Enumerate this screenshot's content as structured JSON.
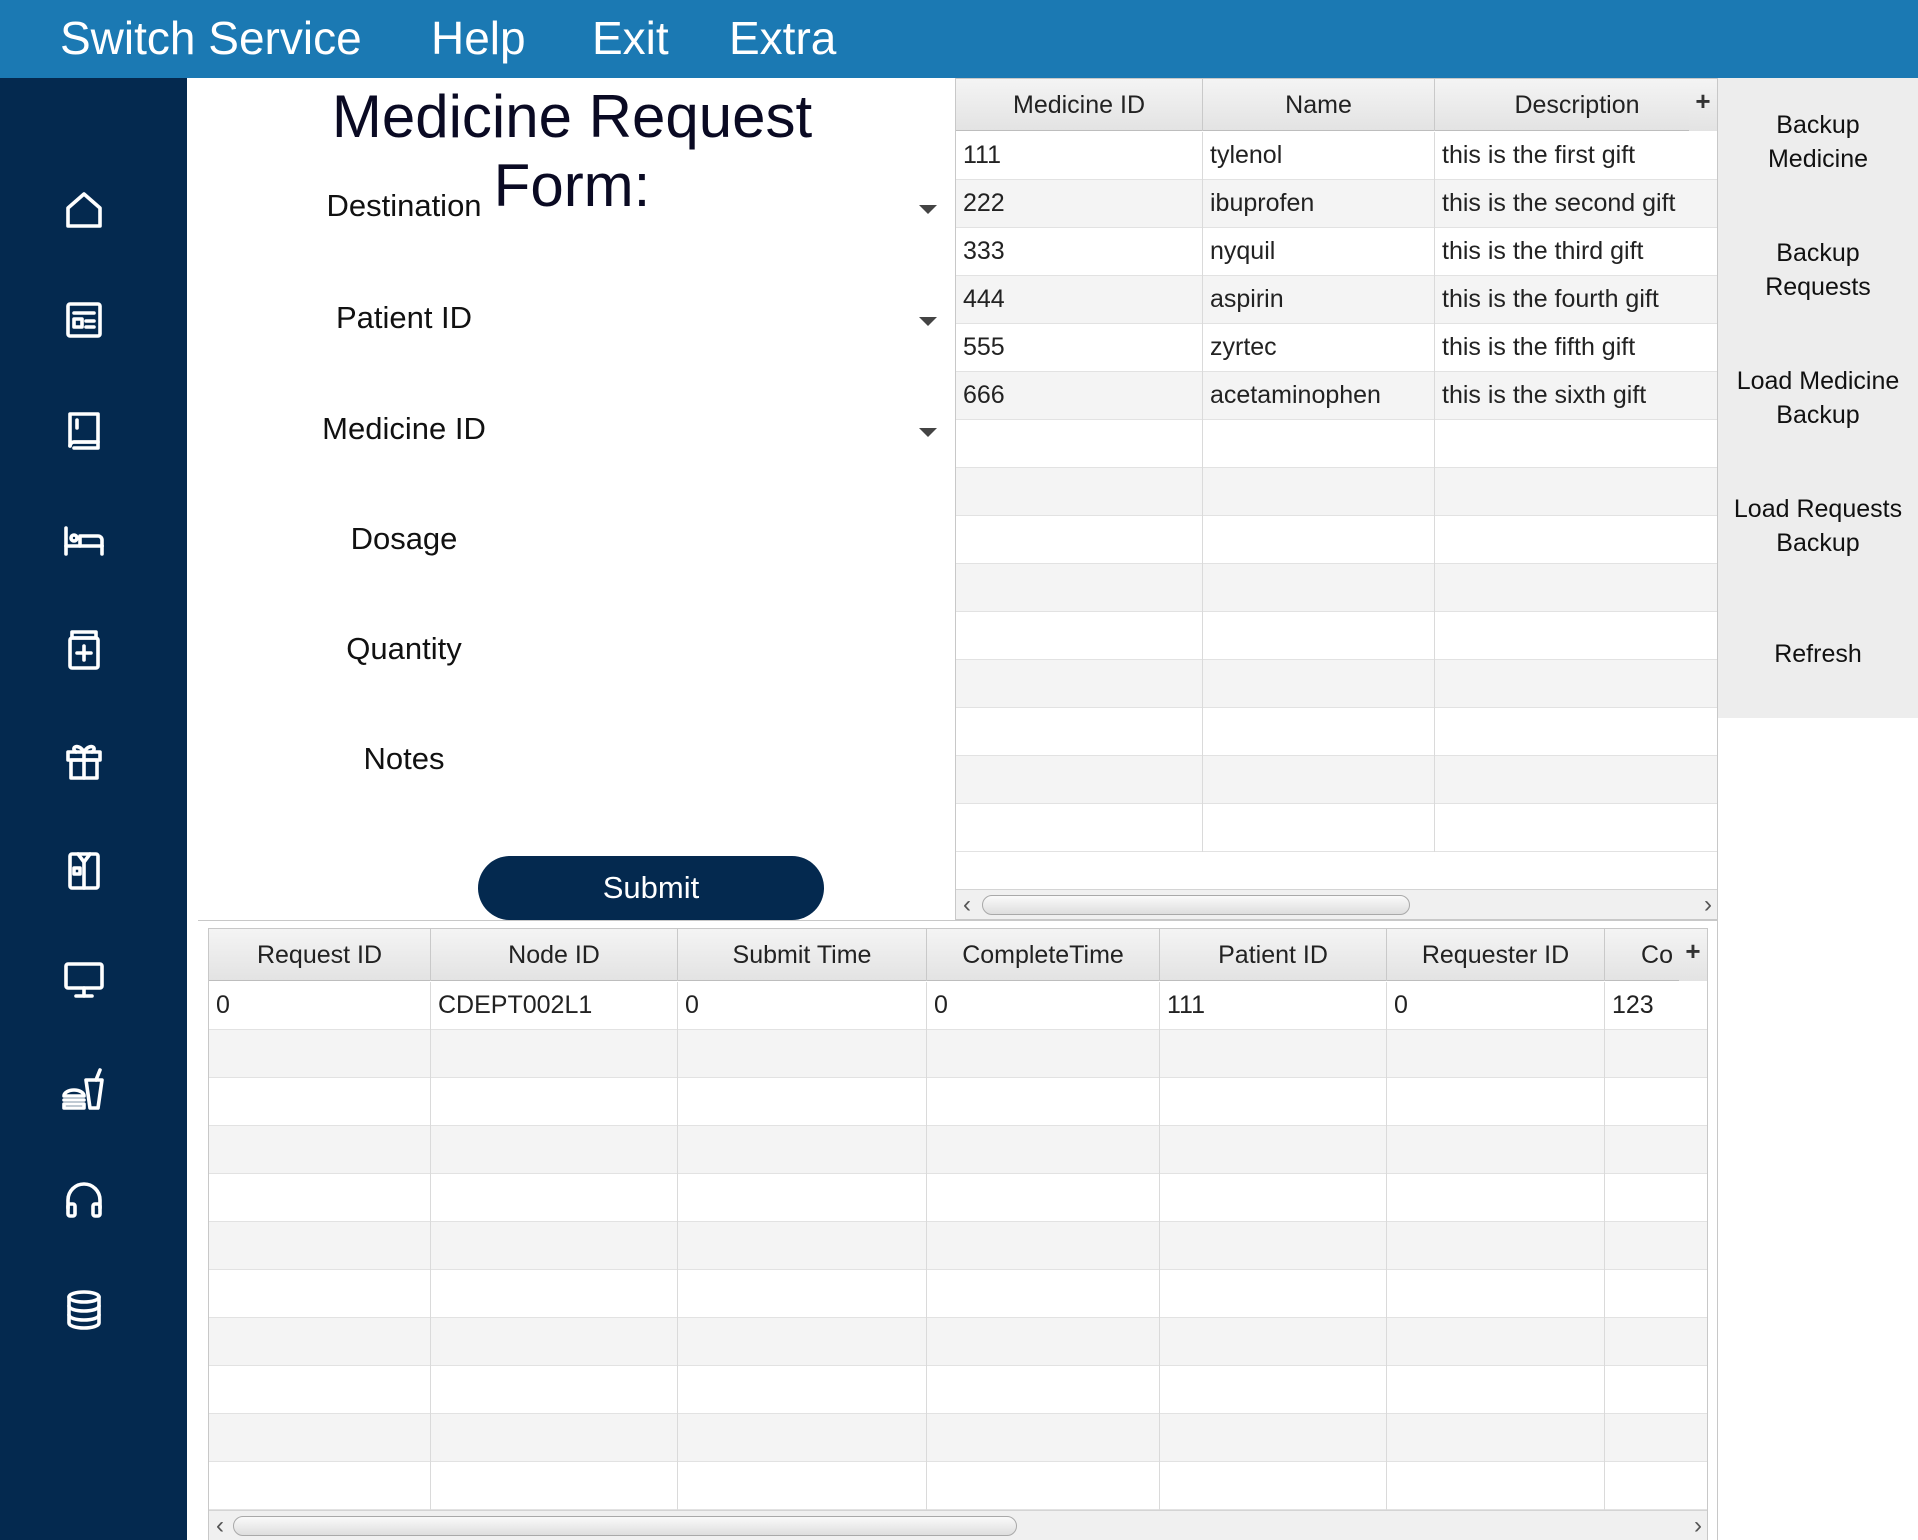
{
  "menubar": {
    "items": [
      "Switch Service",
      "Help",
      "Exit",
      "Extra"
    ]
  },
  "sidebar": {
    "icons": [
      "home-icon",
      "document-icon",
      "book-icon",
      "bed-icon",
      "medicine-icon",
      "gift-icon",
      "clipboard-icon",
      "computer-icon",
      "food-icon",
      "headset-icon",
      "database-icon"
    ]
  },
  "form": {
    "title": "Medicine Request Form:",
    "fields": {
      "destination": "Destination",
      "patient_id": "Patient ID",
      "medicine_id": "Medicine ID",
      "dosage": "Dosage",
      "quantity": "Quantity",
      "notes": "Notes"
    },
    "submit_label": "Submit"
  },
  "medicine_table": {
    "columns": [
      "Medicine ID",
      "Name",
      "Description"
    ],
    "rows": [
      [
        "111",
        "tylenol",
        "this is the first gift"
      ],
      [
        "222",
        "ibuprofen",
        "this is the second gift"
      ],
      [
        "333",
        "nyquil",
        "this is the third gift"
      ],
      [
        "444",
        "aspirin",
        "this is the fourth gift"
      ],
      [
        "555",
        "zyrtec",
        "this is the fifth gift"
      ],
      [
        "666",
        "acetaminophen",
        "this is the sixth gift"
      ]
    ],
    "plus": "+"
  },
  "request_table": {
    "columns": [
      "Request ID",
      "Node ID",
      "Submit Time",
      "CompleteTime",
      "Patient ID",
      "Requester ID",
      "Co"
    ],
    "rows": [
      [
        "0",
        "CDEPT002L1",
        "0",
        "0",
        "111",
        "0",
        "123"
      ]
    ],
    "plus": "+"
  },
  "actions": {
    "backup_medicine": "Backup\nMedicine",
    "backup_requests": "Backup\nRequests",
    "load_medicine_backup": "Load Medicine\nBackup",
    "load_requests_backup": "Load Requests\nBackup",
    "refresh": "Refresh"
  },
  "scroll": {
    "left_arrow": "‹",
    "right_arrow": "›"
  }
}
